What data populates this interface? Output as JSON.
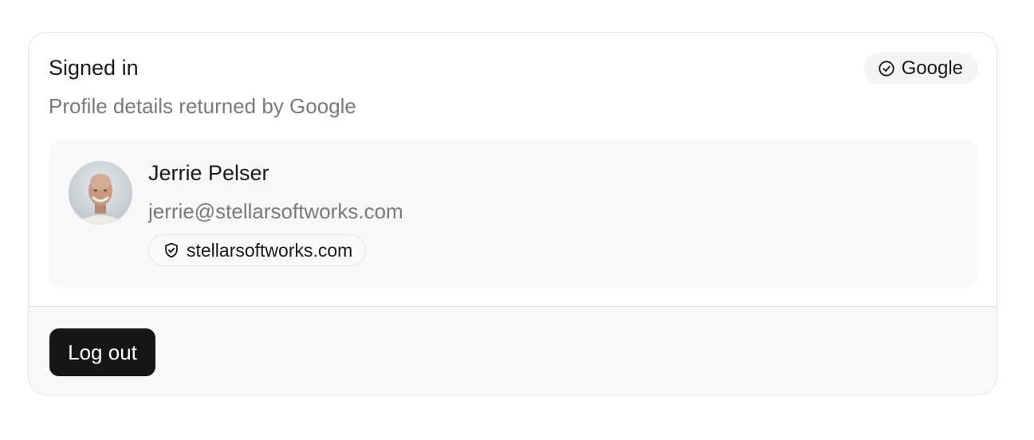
{
  "header": {
    "title": "Signed in",
    "subtitle": "Profile details returned by Google",
    "provider_badge": {
      "icon": "check-circle-icon",
      "label": "Google"
    }
  },
  "profile": {
    "avatar": "user-avatar-photo",
    "name": "Jerrie Pelser",
    "email": "jerrie@stellarsoftworks.com",
    "domain_badge": {
      "icon": "shield-check-icon",
      "label": "stellarsoftworks.com"
    }
  },
  "footer": {
    "logout_label": "Log out"
  },
  "colors": {
    "button_bg": "#161616",
    "muted_text": "#7a7a7a",
    "panel_bg": "#f8f8f8",
    "border": "#e4e4e4"
  }
}
